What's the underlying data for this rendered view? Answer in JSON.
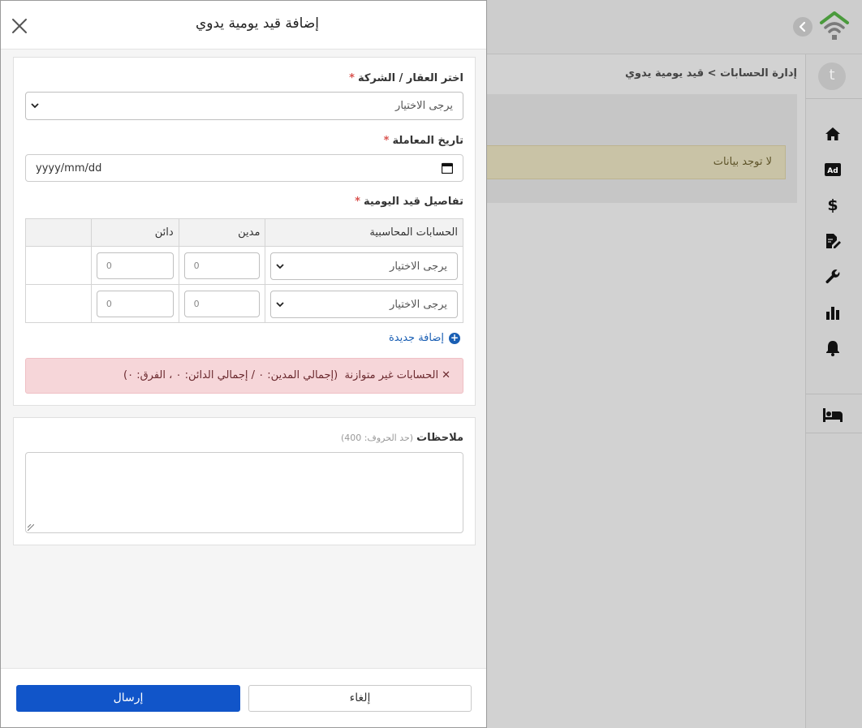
{
  "modal": {
    "title": "إضافة قيد يومية يدوي",
    "property_label": "اختر العقار / الشركة",
    "property_value": "يرجى الاختيار",
    "date_label": "تاريخ المعاملة",
    "date_value": "yyyy/mm/dd",
    "details_label": "تفاصيل قيد اليومية",
    "required_mark": "*",
    "table": {
      "headers": [
        "الحسابات المحاسبية",
        "مدين",
        "دائن",
        ""
      ],
      "rows": [
        {
          "account": "يرجى الاختيار",
          "debit": "0",
          "credit": "0"
        },
        {
          "account": "يرجى الاختيار",
          "debit": "0",
          "credit": "0"
        }
      ]
    },
    "add_new_label": "إضافة جديدة",
    "alert": {
      "icon": "✕",
      "text": "الحسابات غير متوازنة",
      "details": "(إجمالي المدين: ٠ / إجمالي الدائن: ٠ ، الفرق: ٠)"
    },
    "notes_label": "ملاحظات",
    "notes_limit": "(حد الحروف: 400)",
    "notes_value": "",
    "cancel_label": "إلغاء",
    "submit_label": "إرسال"
  },
  "background": {
    "breadcrumb": "إدارة الحسابات > قيد يومية يدوي",
    "empty_message": "لا توجد بيانات",
    "avatar_initial": "t",
    "sidebar_icons": [
      "home-icon",
      "ad-icon",
      "dollar-icon",
      "document-edit-icon",
      "wrench-icon",
      "bar-chart-icon",
      "bell-icon",
      "bed-icon"
    ]
  },
  "colors": {
    "primary": "#1155c9",
    "link": "#1a5fb4",
    "alert_bg": "#f6d6d9",
    "required": "#d9534f",
    "logo_green": "#4a9a3c"
  }
}
